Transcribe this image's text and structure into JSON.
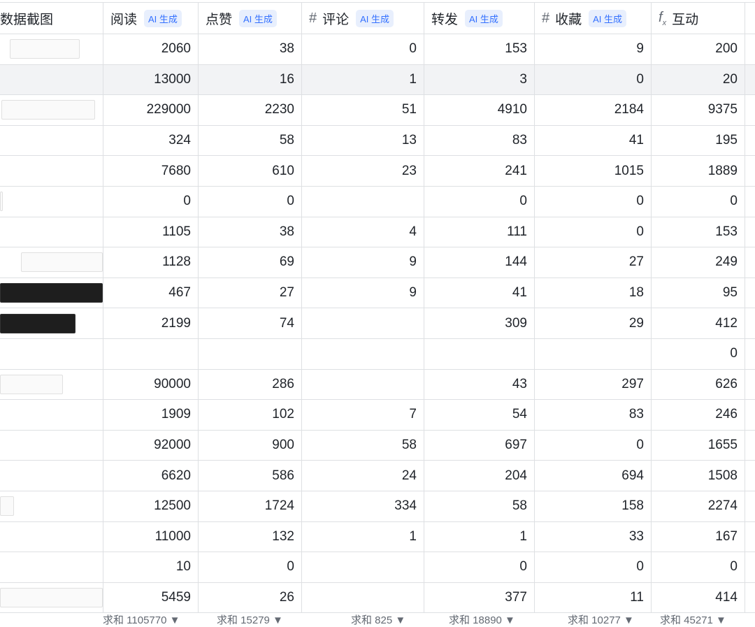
{
  "header": {
    "screenshot": "数据截图",
    "read": "阅读",
    "like": "点赞",
    "comment": "评论",
    "share": "转发",
    "fav": "收藏",
    "interact": "互动",
    "ai_badge": "AI 生成"
  },
  "rows": [
    [
      "2060",
      "38",
      "0",
      "153",
      "9",
      "200"
    ],
    [
      "13000",
      "16",
      "1",
      "3",
      "0",
      "20"
    ],
    [
      "229000",
      "2230",
      "51",
      "4910",
      "2184",
      "9375"
    ],
    [
      "324",
      "58",
      "13",
      "83",
      "41",
      "195"
    ],
    [
      "7680",
      "610",
      "23",
      "241",
      "1015",
      "1889"
    ],
    [
      "0",
      "0",
      "",
      "0",
      "0",
      "0"
    ],
    [
      "1105",
      "38",
      "4",
      "111",
      "0",
      "153"
    ],
    [
      "1128",
      "69",
      "9",
      "144",
      "27",
      "249"
    ],
    [
      "467",
      "27",
      "9",
      "41",
      "18",
      "95"
    ],
    [
      "2199",
      "74",
      "",
      "309",
      "29",
      "412"
    ],
    [
      "",
      "",
      "",
      "",
      "",
      "0"
    ],
    [
      "90000",
      "286",
      "",
      "43",
      "297",
      "626"
    ],
    [
      "1909",
      "102",
      "7",
      "54",
      "83",
      "246"
    ],
    [
      "92000",
      "900",
      "58",
      "697",
      "0",
      "1655"
    ],
    [
      "6620",
      "586",
      "24",
      "204",
      "694",
      "1508"
    ],
    [
      "12500",
      "1724",
      "334",
      "58",
      "158",
      "2274"
    ],
    [
      "11000",
      "132",
      "1",
      "1",
      "33",
      "167"
    ],
    [
      "10",
      "0",
      "",
      "0",
      "0",
      "0"
    ],
    [
      "5459",
      "26",
      "",
      "377",
      "11",
      "414"
    ]
  ],
  "footer": [
    "求和 1105770 ▼",
    "求和 15279 ▼",
    "求和 825 ▼",
    "求和 18890 ▼",
    "求和 10277 ▼",
    "求和 45271 ▼"
  ],
  "colors": {
    "ai_badge_bg": "#e8effd",
    "ai_badge_text": "#3370ff",
    "hover_row": "#f2f3f5"
  }
}
